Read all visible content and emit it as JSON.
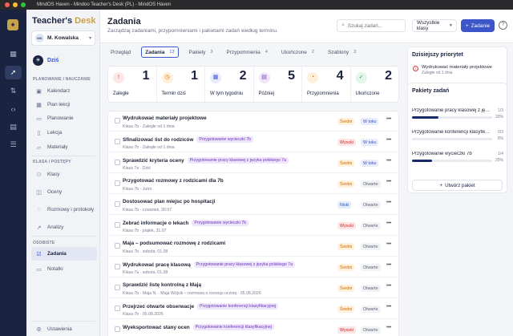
{
  "window": {
    "title": "MindOS Haven - Mindoo Teacher's Desk (PL) - MindOS Haven"
  },
  "brand": {
    "name": "Teacher's",
    "accent": "Desk"
  },
  "user": {
    "initials": "MK",
    "name": "M. Kowalska"
  },
  "today_label": "Dziś",
  "sidebar": {
    "section_planning": "PLANOWANIE I NAUCZANIE",
    "planning_items": [
      "Kalendarz",
      "Plan lekcji",
      "Planowanie",
      "Lekcja",
      "Materiały"
    ],
    "section_classes": "KLASA I POSTĘPY",
    "class_items": [
      "Klasy",
      "Oceny",
      "Rozmowy i protokoły",
      "Analizy"
    ],
    "section_personal": "OSOBISTE",
    "personal_items": [
      "Zadania",
      "Notatki"
    ],
    "settings": "Ustawienia"
  },
  "header": {
    "title": "Zadania",
    "subtitle": "Zarządzaj zadaniami, przypomnieniami i pakietami zadań według terminu.",
    "search_placeholder": "Szukaj zadań...",
    "class_filter": "Wszystkie klasy",
    "add_label": "Zadanie"
  },
  "tabs": [
    {
      "label": "Przegląd",
      "count": ""
    },
    {
      "label": "Zadania",
      "count": "13"
    },
    {
      "label": "Pakiety",
      "count": "3"
    },
    {
      "label": "Przypomnienia",
      "count": "4"
    },
    {
      "label": "Ukończone",
      "count": "2"
    },
    {
      "label": "Szablony",
      "count": "3"
    }
  ],
  "stats": [
    {
      "label": "Zaległe",
      "value": "1",
      "color": "#d33b3b",
      "bg": "#fde8e8",
      "icon": "!"
    },
    {
      "label": "Termin dziś",
      "value": "1",
      "color": "#c66a00",
      "bg": "#fff0dc",
      "icon": "◷"
    },
    {
      "label": "W tym tygodniu",
      "value": "2",
      "color": "#3c55c8",
      "bg": "#e8ecfb",
      "icon": "▦"
    },
    {
      "label": "Później",
      "value": "5",
      "color": "#7a3fc0",
      "bg": "#f0e6fb",
      "icon": "▤"
    },
    {
      "label": "Przypomnienia",
      "value": "4",
      "color": "#c66a00",
      "bg": "#fff0dc",
      "icon": "◔"
    },
    {
      "label": "Ukończone",
      "value": "2",
      "color": "#1f9a55",
      "bg": "#e3f6ea",
      "icon": "✓"
    }
  ],
  "tasks": [
    {
      "title": "Wydrukować materiały projektowe",
      "tag": "",
      "meta": "Klasa 7b · Zaległe od 1 dnia",
      "priority": "Średni",
      "pclass": "sredni",
      "status": "W toku",
      "sclass": "wtoku"
    },
    {
      "title": "Sfinalizować list do rodziców",
      "tag": "Przygotowanie wycieczki 7b",
      "meta": "Klasa 7b · Zaległe od 1 dnia",
      "priority": "Wysoki",
      "pclass": "wysoki",
      "status": "W toku",
      "sclass": "wtoku"
    },
    {
      "title": "Sprawdzić kryteria oceny",
      "tag": "Przygotowanie pracy klasowej z języka polskiego 7a",
      "meta": "Klasa 7a · Dziś",
      "priority": "Średni",
      "pclass": "sredni",
      "status": "W toku",
      "sclass": "wtoku"
    },
    {
      "title": "Przygotować rozmowy z rodzicami dla 7b",
      "tag": "",
      "meta": "Klasa 7b · Jutro",
      "priority": "Średni",
      "pclass": "sredni",
      "status": "Otwarte",
      "sclass": ""
    },
    {
      "title": "Dostosować plan miejsc po hospitacji",
      "tag": "",
      "meta": "Klasa 7b · czwartek, 30.07",
      "priority": "Niski",
      "pclass": "niski",
      "status": "Otwarte",
      "sclass": ""
    },
    {
      "title": "Zebrać informacje o lekach",
      "tag": "Przygotowanie wycieczki 7b",
      "meta": "Klasa 7b · piątek, 31.07",
      "priority": "Wysoki",
      "pclass": "wysoki",
      "status": "Otwarte",
      "sclass": ""
    },
    {
      "title": "Maja – podsumować rozmowę z rodzicami",
      "tag": "",
      "meta": "Klasa 7b · sobota, 01.08",
      "priority": "Średni",
      "pclass": "sredni",
      "status": "Otwarte",
      "sclass": ""
    },
    {
      "title": "Wydrukować pracę klasową",
      "tag": "Przygotowanie pracy klasowej z języka polskiego 7a",
      "meta": "Klasa 7a · sobota, 01.08",
      "priority": "Średni",
      "pclass": "sredni",
      "status": "Otwarte",
      "sclass": ""
    },
    {
      "title": "Sprawdzić listę kontrolną z Mają",
      "tag": "",
      "meta": "Klasa 7b · Maja N. · Maja Wójcik – rozmowa o rozwoju ucznia · 05.08.2026",
      "priority": "Średni",
      "pclass": "sredni",
      "status": "Otwarte",
      "sclass": ""
    },
    {
      "title": "Przejrzeć otwarte obserwacje",
      "tag": "Przygotowanie konferencji klasyfikacyjnej",
      "meta": "Klasa 7b · 05.08.2026",
      "priority": "Średni",
      "pclass": "sredni",
      "status": "Otwarte",
      "sclass": ""
    },
    {
      "title": "Wyeksportować stany ocen",
      "tag": "Przygotowanie konferencji klasyfikacyjnej",
      "meta": "",
      "priority": "Wysoki",
      "pclass": "wysoki",
      "status": "Otwarte",
      "sclass": ""
    }
  ],
  "priority_panel": {
    "title": "Dzisiejszy priorytet",
    "item_title": "Wydrukować materiały projektowe",
    "item_meta": "Zaległe od 1 dnia"
  },
  "packages_panel": {
    "title": "Pakiety zadań",
    "items": [
      {
        "name": "Przygotowanie pracy klasowej z języka polskiego 7a",
        "count": "1/3",
        "percent": "33%",
        "fraction": 0.33
      },
      {
        "name": "Przygotowanie konferencji klasyfikacyjnej",
        "count": "0/3",
        "percent": "0%",
        "fraction": 0.0
      },
      {
        "name": "Przygotowanie wycieczki 7b",
        "count": "1/4",
        "percent": "25%",
        "fraction": 0.25
      }
    ],
    "create_label": "Utwórz pakiet"
  }
}
